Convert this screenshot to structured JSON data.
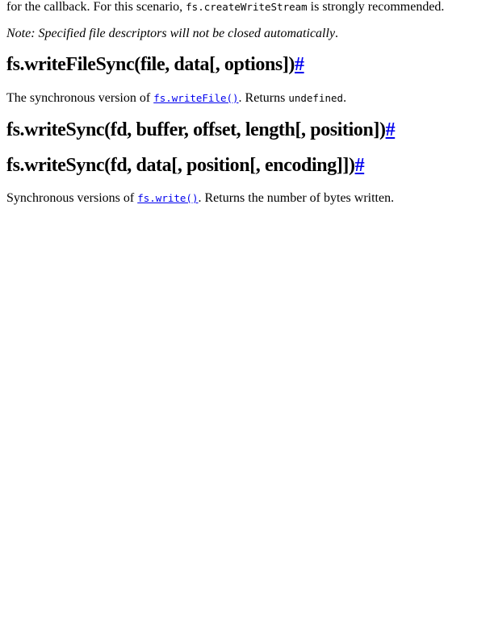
{
  "paragraph_callback": {
    "text_before": "for the callback. For this scenario, ",
    "code": "fs.createWriteStream",
    "text_after": " is strongly recommended."
  },
  "note": {
    "text": "Note: Specified file descriptors will not be closed automatically",
    "tail": "."
  },
  "heading_writefilesync": {
    "text": "fs.writeFileSync(file, data[, options])",
    "anchor": "#"
  },
  "paragraph_writefilesync": {
    "text_before": "The synchronous version of ",
    "link_code": "fs.writeFile()",
    "text_middle": ". Returns ",
    "code": "undefined",
    "text_after": "."
  },
  "heading_writesync_buffer": {
    "text": "fs.writeSync(fd, buffer, offset, length[, position])",
    "anchor": "#"
  },
  "heading_writesync_data": {
    "text": "fs.writeSync(fd, data[, position[, encoding]])",
    "anchor": "#"
  },
  "paragraph_writesync": {
    "text_before": "Synchronous versions of ",
    "link_code": "fs.write()",
    "text_after": ". Returns the number of bytes written."
  }
}
